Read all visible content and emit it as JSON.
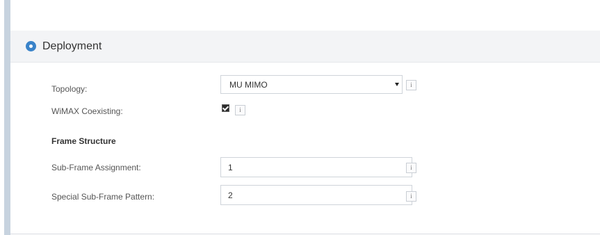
{
  "panel": {
    "title": "Deployment",
    "toggle_icon": "collapse-circle-icon"
  },
  "fields": {
    "topology": {
      "label": "Topology:",
      "value": "MU MIMO",
      "info_glyph": "i"
    },
    "wimax_coexisting": {
      "label": "WiMAX Coexisting:",
      "checked": true,
      "info_glyph": "i"
    },
    "frame_structure": {
      "heading": "Frame Structure"
    },
    "sub_frame_assignment": {
      "label": "Sub-Frame Assignment:",
      "value": "1",
      "info_glyph": "i"
    },
    "special_sub_frame_pattern": {
      "label": "Special Sub-Frame Pattern:",
      "value": "2",
      "info_glyph": "i"
    }
  },
  "colors": {
    "accent": "#3a83c9",
    "header_bg": "#f3f4f6",
    "rail": "#c7d3df"
  }
}
